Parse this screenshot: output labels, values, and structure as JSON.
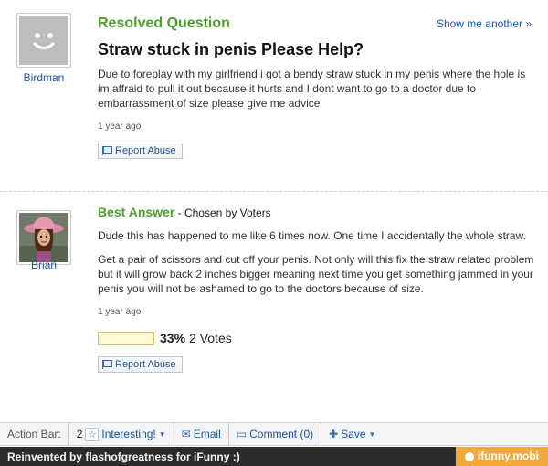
{
  "question": {
    "status": "Resolved Question",
    "show_another": "Show me another »",
    "title": "Straw stuck in penis Please Help?",
    "body": "Due to foreplay with my girlfriend i got a bendy straw stuck in my penis where the hole is im affraid to pull it out because it hurts and I dont want to go to a doctor due to embarrassment of size please give me advice",
    "time": "1 year ago",
    "report": "Report Abuse",
    "user": "Birdman"
  },
  "answer": {
    "heading": "Best Answer",
    "chosen": " - Chosen by Voters",
    "para1": "Dude this has happened to me like 6 times now. One time I accidentally the whole straw.",
    "para2": "Get a pair of scissors and cut off your penis. Not only will this fix the straw related problem but it will grow back 2 inches bigger meaning next time you get something jammed in your penis you will not be ashamed to go to the doctors because of size.",
    "time": "1 year ago",
    "vote_pct": "33%",
    "vote_count": "2 Votes",
    "report": "Report Abuse",
    "user": "Brian"
  },
  "action_bar": {
    "label": "Action Bar:",
    "interesting_count": "2",
    "interesting": "Interesting!",
    "email": "Email",
    "comment": "Comment (0)",
    "save": "Save"
  },
  "footer": {
    "credit": "Reinvented by flashofgreatness for iFunny :)",
    "brand": "ifunny.mobi"
  },
  "icons": {
    "default_avatar": "default-avatar-icon",
    "flag": "flag-icon",
    "star": "star-icon",
    "email": "envelope-icon",
    "comment": "speech-bubble-icon",
    "save": "plus-icon"
  },
  "colors": {
    "accent_green": "#4aa12a",
    "link_blue": "#1a55a7",
    "footer_bg": "#2c2c2c",
    "brand_orange": "#f2a93b"
  }
}
